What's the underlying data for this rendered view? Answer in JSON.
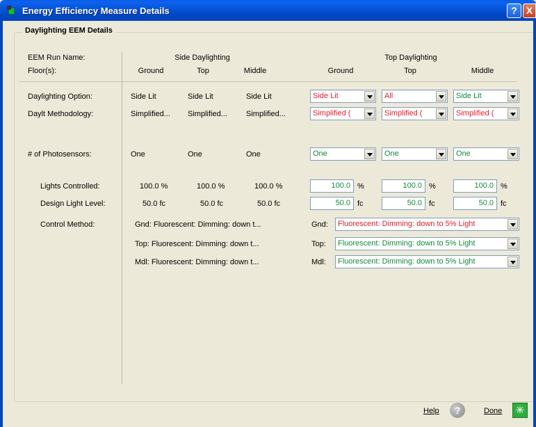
{
  "window": {
    "title": "Energy Efficiency Measure Details",
    "help_glyph": "?",
    "close_glyph": "X"
  },
  "group": {
    "title": "Daylighting EEM Details"
  },
  "labels": {
    "run_name": "EEM Run Name:",
    "floors": "Floor(s):",
    "option": "Daylighting Option:",
    "methodology": "Daylt Methodology:",
    "photosensors": "# of Photosensors:",
    "lights_controlled": "Lights Controlled:",
    "design_light_level": "Design Light Level:",
    "control_method": "Control Method:"
  },
  "side": {
    "header": "Side Daylighting",
    "floors": [
      "Ground",
      "Top",
      "Middle"
    ],
    "option": [
      "Side Lit",
      "Side Lit",
      "Side Lit"
    ],
    "methodology": [
      "Simplified...",
      "Simplified...",
      "Simplified..."
    ],
    "photosensors": [
      "One",
      "One",
      "One"
    ],
    "lights_controlled": [
      "100.0 %",
      "100.0 %",
      "100.0 %"
    ],
    "design_light_level": [
      "50.0 fc",
      "50.0 fc",
      "50.0 fc"
    ],
    "control_method": [
      "Gnd: Fluorescent: Dimming: down t...",
      "Top: Fluorescent: Dimming: down t...",
      "Mdl: Fluorescent: Dimming: down t..."
    ]
  },
  "top": {
    "header": "Top Daylighting",
    "floors": [
      "Ground",
      "Top",
      "Middle"
    ],
    "option": [
      "Side Lit",
      "All",
      "Side Lit"
    ],
    "methodology": [
      "Simplified (",
      "Simplified (",
      "Simplified ("
    ],
    "photosensors": [
      "One",
      "One",
      "One"
    ],
    "lights_controlled": [
      "100.0",
      "100.0",
      "100.0"
    ],
    "lights_unit": "%",
    "design_light_level": [
      "50.0",
      "50.0",
      "50.0"
    ],
    "light_unit": "fc",
    "control_prefix": [
      "Gnd:",
      "Top:",
      "Mdl:"
    ],
    "control_method": [
      "Fluorescent: Dimming: down to 5% Light",
      "Fluorescent: Dimming: down to 5% Light",
      "Fluorescent: Dimming: down to 5% Light"
    ]
  },
  "footer": {
    "help_label": "Help",
    "help_glyph": "?",
    "done_label": "Done",
    "done_glyph": "✳"
  },
  "colors": {
    "modified": "#E0202C",
    "default": "#118A3A",
    "titlebar": "#0553D6",
    "background": "#ECE9D8"
  }
}
